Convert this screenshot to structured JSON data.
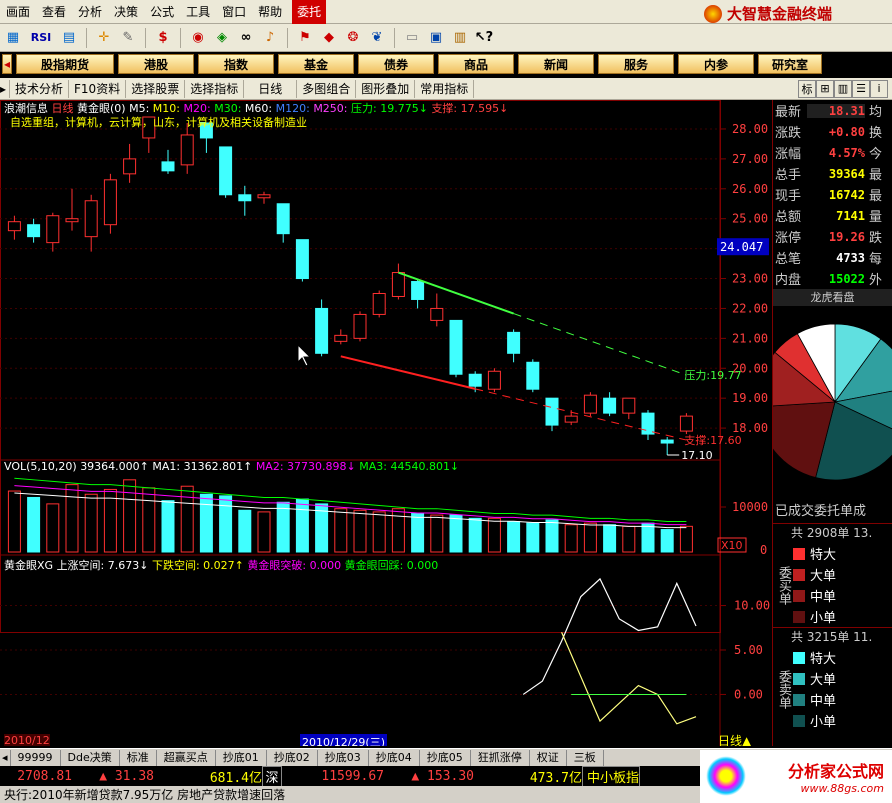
{
  "menubar": {
    "items": [
      "画面",
      "查看",
      "分析",
      "决策",
      "公式",
      "工具",
      "窗口",
      "帮助"
    ],
    "active": "委托",
    "brand": "大智慧金融终端"
  },
  "toolbar": {
    "rsi_label": "RSI"
  },
  "nav": {
    "items": [
      "股指期货",
      "港股",
      "指数",
      "基金",
      "债券",
      "商品",
      "新闻",
      "服务",
      "内参",
      "研究室"
    ]
  },
  "subnav": {
    "items": [
      "技术分析",
      "F10资料",
      "选择股票",
      "选择指标",
      "日线",
      "多图组合",
      "图形叠加",
      "常用指标"
    ],
    "right_tab": "标"
  },
  "chart": {
    "header": {
      "stock": "浪潮信息",
      "period": "日线",
      "indicator": "黄金眼(0)",
      "ma5": "M5:",
      "ma10": "M10:",
      "ma20": "M20:",
      "ma30": "M30:",
      "ma60": "M60:",
      "ma120": "M120:",
      "ma250": "M250:",
      "pressure": "压力: 19.775↓",
      "support": "支撑: 17.595↓"
    },
    "sector": "自选重组，计算机，云计算，山东，计算机及相关设备制造业",
    "price_axis": [
      "28.00",
      "27.00",
      "26.00",
      "25.00",
      "24.00",
      "23.00",
      "22.00",
      "21.00",
      "20.00",
      "19.00",
      "18.00"
    ],
    "current_price": "24.047",
    "pressure_label": "压力:19.77",
    "support_label": "支撑:17.60",
    "low_label": "17.10",
    "vol_header": {
      "name": "VOL(5,10,20)",
      "value": "39364.000↑",
      "ma1": "MA1: 31362.801↑",
      "ma2": "MA2: 37730.898↓",
      "ma3": "MA3: 44540.801↓"
    },
    "vol_axis": [
      "10000",
      "0"
    ],
    "vol_unit": "X10",
    "xg_header": {
      "name": "黄金眼XG",
      "up": "上涨空间: 7.673↓",
      "down": "下跌空间: 0.027↑",
      "breakout": "黄金眼突破: 0.000",
      "pullback": "黄金眼回踩: 0.000"
    },
    "xg_axis": [
      "10.00",
      "5.00",
      "0.00"
    ],
    "date_left": "2010/12",
    "date_cursor": "2010/12/29(三)",
    "period_label": "日线"
  },
  "chart_data": {
    "type": "candlestick",
    "title": "浪潮信息 日线",
    "ylim": [
      17.0,
      28.3
    ],
    "candles": [
      {
        "o": 24.6,
        "c": 24.9,
        "h": 25.1,
        "l": 24.3
      },
      {
        "o": 24.8,
        "c": 24.4,
        "h": 25.0,
        "l": 24.2
      },
      {
        "o": 24.2,
        "c": 25.1,
        "h": 25.2,
        "l": 23.9
      },
      {
        "o": 24.9,
        "c": 25.0,
        "h": 26.0,
        "l": 24.6
      },
      {
        "o": 24.4,
        "c": 25.6,
        "h": 25.8,
        "l": 23.9
      },
      {
        "o": 24.8,
        "c": 26.3,
        "h": 26.5,
        "l": 24.5
      },
      {
        "o": 26.5,
        "c": 27.0,
        "h": 27.5,
        "l": 26.2
      },
      {
        "o": 27.7,
        "c": 28.4,
        "h": 28.4,
        "l": 27.2
      },
      {
        "o": 26.9,
        "c": 26.6,
        "h": 27.3,
        "l": 26.5
      },
      {
        "o": 26.8,
        "c": 27.8,
        "h": 28.2,
        "l": 26.5
      },
      {
        "o": 28.2,
        "c": 27.7,
        "h": 28.2,
        "l": 27.2
      },
      {
        "o": 27.4,
        "c": 25.8,
        "h": 27.4,
        "l": 25.7
      },
      {
        "o": 25.8,
        "c": 25.6,
        "h": 26.1,
        "l": 25.1
      },
      {
        "o": 25.7,
        "c": 25.8,
        "h": 25.9,
        "l": 25.5
      },
      {
        "o": 25.5,
        "c": 24.5,
        "h": 25.5,
        "l": 24.2
      },
      {
        "o": 24.3,
        "c": 23.0,
        "h": 24.3,
        "l": 22.9
      },
      {
        "o": 22.0,
        "c": 20.5,
        "h": 22.3,
        "l": 20.4
      },
      {
        "o": 20.9,
        "c": 21.1,
        "h": 21.3,
        "l": 20.8
      },
      {
        "o": 21.0,
        "c": 21.8,
        "h": 21.9,
        "l": 20.9
      },
      {
        "o": 21.8,
        "c": 22.5,
        "h": 22.6,
        "l": 21.7
      },
      {
        "o": 22.4,
        "c": 23.2,
        "h": 23.5,
        "l": 22.3
      },
      {
        "o": 22.9,
        "c": 22.3,
        "h": 23.0,
        "l": 22.0
      },
      {
        "o": 21.6,
        "c": 22.0,
        "h": 22.5,
        "l": 21.4
      },
      {
        "o": 21.6,
        "c": 19.8,
        "h": 21.6,
        "l": 19.7
      },
      {
        "o": 19.8,
        "c": 19.4,
        "h": 19.9,
        "l": 19.2
      },
      {
        "o": 19.3,
        "c": 19.9,
        "h": 20.0,
        "l": 19.2
      },
      {
        "o": 21.2,
        "c": 20.5,
        "h": 21.3,
        "l": 20.2
      },
      {
        "o": 20.2,
        "c": 19.3,
        "h": 20.3,
        "l": 19.2
      },
      {
        "o": 19.0,
        "c": 18.1,
        "h": 19.0,
        "l": 17.9
      },
      {
        "o": 18.2,
        "c": 18.4,
        "h": 18.6,
        "l": 18.1
      },
      {
        "o": 18.5,
        "c": 19.1,
        "h": 19.2,
        "l": 18.4
      },
      {
        "o": 19.0,
        "c": 18.5,
        "h": 19.2,
        "l": 18.4
      },
      {
        "o": 18.5,
        "c": 19.0,
        "h": 19.0,
        "l": 18.3
      },
      {
        "o": 18.5,
        "c": 17.8,
        "h": 18.6,
        "l": 17.6
      },
      {
        "o": 17.6,
        "c": 17.5,
        "h": 17.7,
        "l": 17.1
      },
      {
        "o": 17.9,
        "c": 18.4,
        "h": 18.5,
        "l": 17.8
      }
    ],
    "pressure_line": {
      "from": [
        20,
        23.2
      ],
      "to": [
        35,
        19.77
      ]
    },
    "support_line": {
      "from": [
        17,
        20.4
      ],
      "to": [
        35,
        17.6
      ]
    },
    "volume": [
      3800,
      3400,
      3000,
      4200,
      3600,
      3900,
      4500,
      4000,
      3200,
      4100,
      3600,
      3500,
      2600,
      2500,
      3100,
      3300,
      3000,
      2700,
      2600,
      2500,
      2700,
      2400,
      2300,
      2300,
      2100,
      2100,
      1900,
      1800,
      2000,
      1700,
      1800,
      1700,
      1600,
      1800,
      1400,
      1600
    ],
    "vol_ma": [
      4600,
      4500,
      4400,
      4300,
      4200,
      4200,
      4100,
      4000,
      3900,
      3800,
      3700,
      3600,
      3500,
      3400,
      3400,
      3300,
      3200,
      3100,
      3000,
      2900,
      2800,
      2700,
      2700,
      2600,
      2500,
      2400,
      2400,
      2300,
      2300,
      2200,
      2100,
      2100,
      2000,
      2000,
      1900,
      1900
    ],
    "xg_up": [
      null,
      null,
      null,
      null,
      null,
      null,
      null,
      null,
      null,
      null,
      null,
      null,
      null,
      null,
      null,
      null,
      null,
      null,
      null,
      null,
      null,
      null,
      null,
      null,
      null,
      null,
      null,
      0.0,
      1.5,
      6.0,
      11.0,
      13.0,
      8.5,
      7.2,
      7.6,
      12.5,
      7.7
    ],
    "xg_down": [
      null,
      null,
      null,
      null,
      null,
      null,
      null,
      null,
      null,
      null,
      null,
      null,
      null,
      null,
      null,
      null,
      null,
      null,
      null,
      null,
      null,
      null,
      null,
      null,
      null,
      null,
      null,
      null,
      null,
      7.0,
      2.0,
      -3.0,
      -1.0,
      1.0,
      0.0,
      -3.3,
      -2.5
    ]
  },
  "quote": {
    "rows": [
      {
        "k": "最新",
        "v": "18.31",
        "x": "均",
        "vc": "#ff4040"
      },
      {
        "k": "涨跌",
        "v": "+0.80",
        "x": "换",
        "vc": "#ff4040"
      },
      {
        "k": "涨幅",
        "v": "4.57%",
        "x": "今",
        "vc": "#ff4040"
      },
      {
        "k": "总手",
        "v": "39364",
        "x": "最",
        "vc": "#ffff00"
      },
      {
        "k": "现手",
        "v": "16742",
        "x": "最",
        "vc": "#ffff00"
      },
      {
        "k": "总额",
        "v": "7141",
        "x": "量",
        "vc": "#ffff00"
      },
      {
        "k": "涨停",
        "v": "19.26",
        "x": "跌",
        "vc": "#ff4040"
      },
      {
        "k": "总笔",
        "v": "4733",
        "x": "每",
        "vc": "#ffffff"
      },
      {
        "k": "内盘",
        "v": "15022",
        "x": "外",
        "vc": "#00ff00"
      }
    ],
    "pie_title": "龙虎看盘",
    "order_title": "已成交委托单成",
    "buy": {
      "total": "共 2908单 13.",
      "side": "委买单",
      "items": [
        "特大",
        "大单",
        "中单",
        "小单"
      ]
    },
    "sell": {
      "total": "共 3215单 11.",
      "side": "委卖单",
      "items": [
        "特大",
        "大单",
        "中单",
        "小单"
      ]
    },
    "buy_colors": [
      "#ff3030",
      "#c02020",
      "#901818",
      "#601010"
    ],
    "sell_colors": [
      "#40ffff",
      "#30c0c0",
      "#208080",
      "#105050"
    ]
  },
  "bottom_tabs": [
    "99999",
    "Dde决策",
    "标准",
    "超赢买点",
    "抄底01",
    "抄底02",
    "抄底03",
    "抄底04",
    "抄底05",
    "狂抓涨停",
    "权证",
    "三板"
  ],
  "index_row": {
    "sh": "2708.81",
    "sh_chg": "▲ 31.38",
    "sh_amt": "681.4亿",
    "sz_label": "深",
    "sz": "11599.67",
    "sz_chg": "▲ 153.30",
    "sz_amt": "473.7亿",
    "board": "中小板指"
  },
  "ticker": "央行:2010年新增贷款7.95万亿 房地产贷款增速回落",
  "watermark": {
    "name": "分析家公式网",
    "url": "www.88gs.com"
  }
}
